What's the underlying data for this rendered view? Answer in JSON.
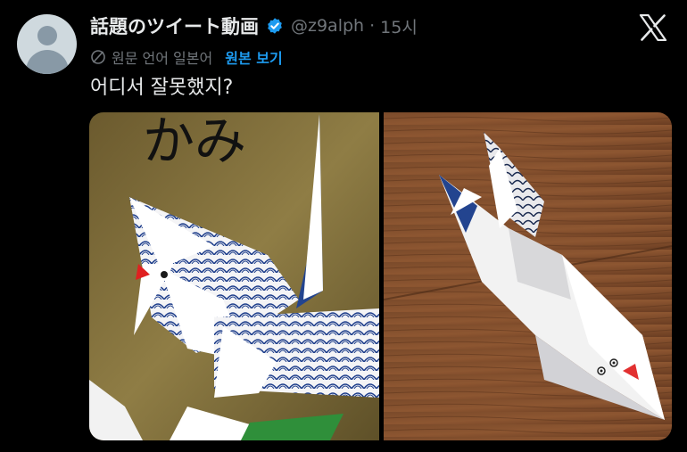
{
  "tweet": {
    "display_name": "話題のツイート動画",
    "handle": "@z9alph",
    "separator": "·",
    "time": "15시",
    "translation_note": "원문 언어 일본어",
    "show_original": "원본 보기",
    "text": "어디서 잘못했지?",
    "handwriting_left_photo": "かみ"
  },
  "icons": {
    "avatar": "default-avatar-icon",
    "verified": "verified-badge-icon",
    "translate": "translate-icon",
    "platform": "x-logo-icon"
  },
  "colors": {
    "background": "#000000",
    "text_primary": "#e7e9ea",
    "text_secondary": "#71767b",
    "accent": "#1d9bf0"
  }
}
